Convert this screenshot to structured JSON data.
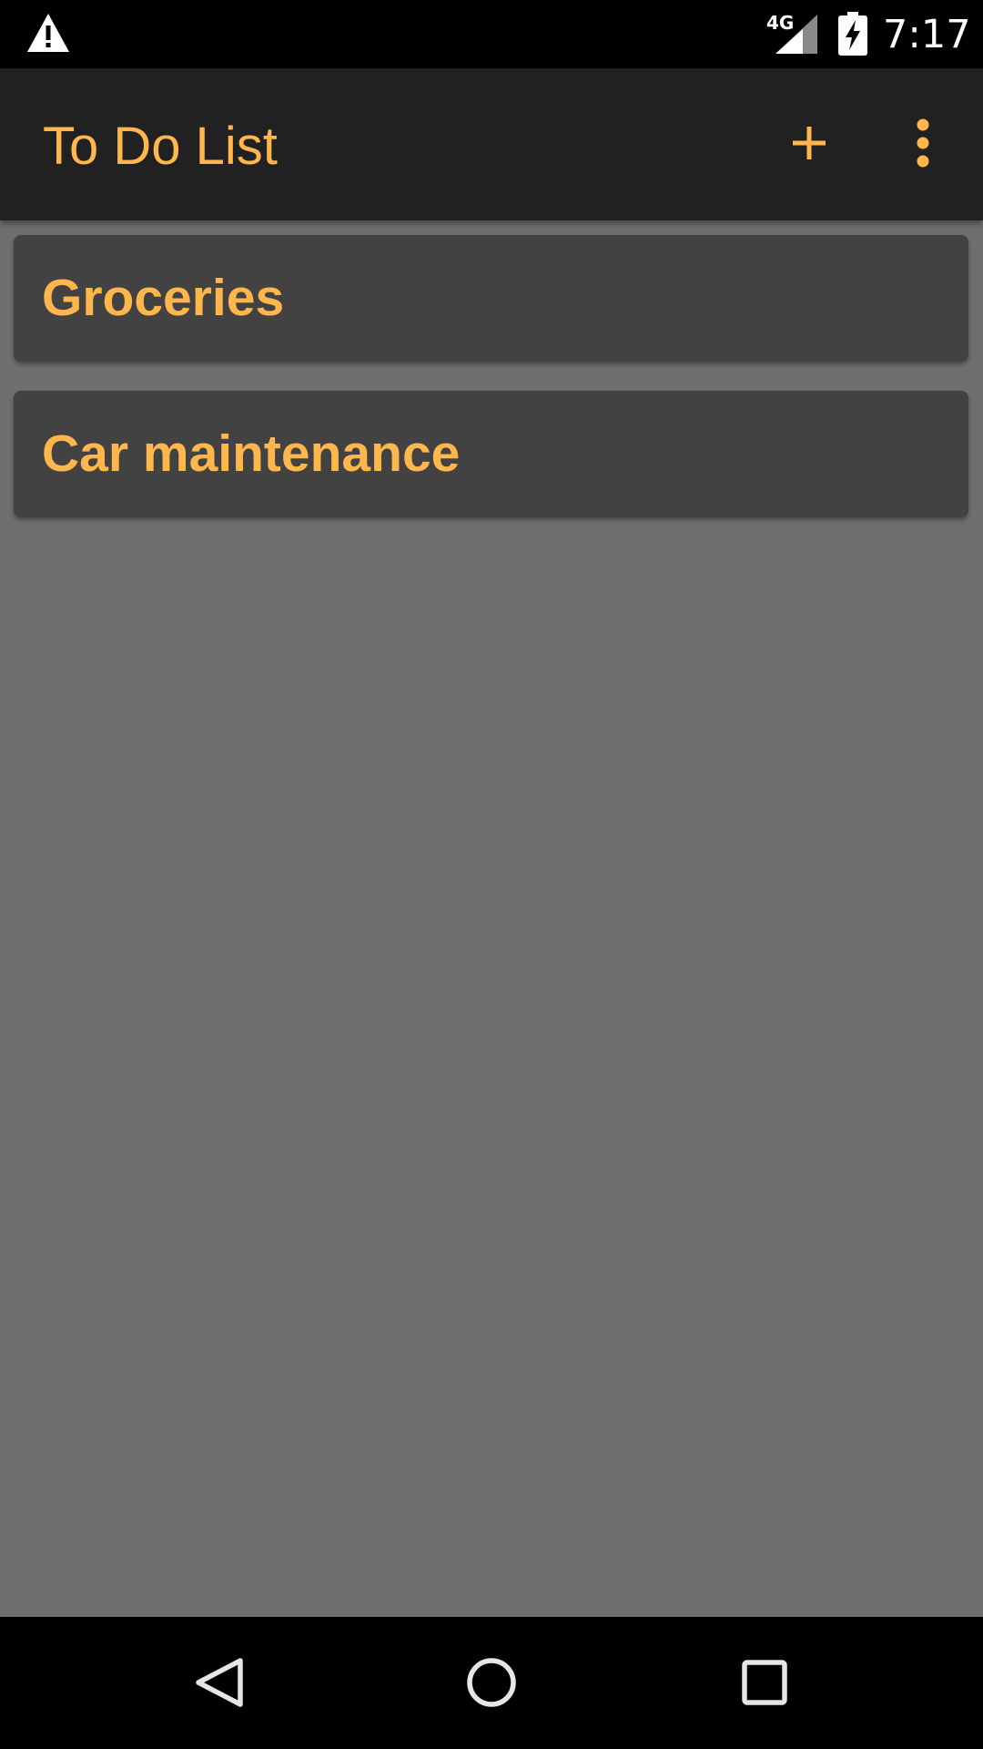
{
  "status_bar": {
    "network_type": "4G",
    "time": "7:17",
    "icons": [
      "warning-icon",
      "signal-icon",
      "battery-charging-icon"
    ]
  },
  "app_bar": {
    "title": "To Do List",
    "actions": [
      "add-icon",
      "more-vert-icon"
    ]
  },
  "lists": [
    {
      "label": "Groceries"
    },
    {
      "label": "Car maintenance"
    }
  ],
  "nav_bar": {
    "icons": [
      "back-icon",
      "home-icon",
      "recents-icon"
    ]
  },
  "colors": {
    "accent": "#ffb74d",
    "app_bar_bg": "#212121",
    "card_bg": "#424242",
    "content_bg": "#6f6f6f",
    "system_bar_bg": "#000000"
  }
}
